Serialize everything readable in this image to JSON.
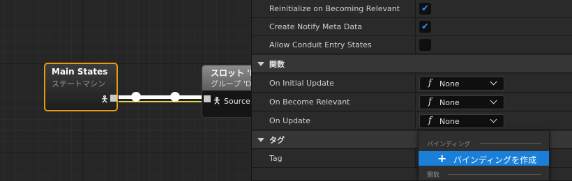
{
  "graph": {
    "main_node": {
      "title": "Main States",
      "subtitle": "ステートマシン"
    },
    "slot_node": {
      "title": "スロット 'D",
      "subtitle": "グループ 'D",
      "pin_label": "Source"
    }
  },
  "details": {
    "rows_top": [
      {
        "label": "Reinitialize on Becoming Relevant",
        "checked": true
      },
      {
        "label": "Create Notify Meta Data",
        "checked": true
      },
      {
        "label": "Allow Conduit Entry States",
        "checked": false
      }
    ],
    "category_functions": "関数",
    "function_rows": [
      {
        "label": "On Initial Update",
        "value": "None",
        "icon": "function-icon"
      },
      {
        "label": "On Become Relevant",
        "value": "None",
        "icon": "function-icon"
      },
      {
        "label": "On Update",
        "value": "None",
        "icon": "function-icon"
      }
    ],
    "function_glyph": "f",
    "category_tags": "タグ",
    "tag_row": {
      "label": "Tag"
    }
  },
  "dropdown": {
    "section_binding": "バインディング",
    "item_create_binding": "バインディングを作成",
    "section_functions": "関数"
  },
  "colors": {
    "selection_orange": "#e89a12",
    "accent_blue": "#1a7fd8",
    "check_blue": "#2f8fff"
  }
}
